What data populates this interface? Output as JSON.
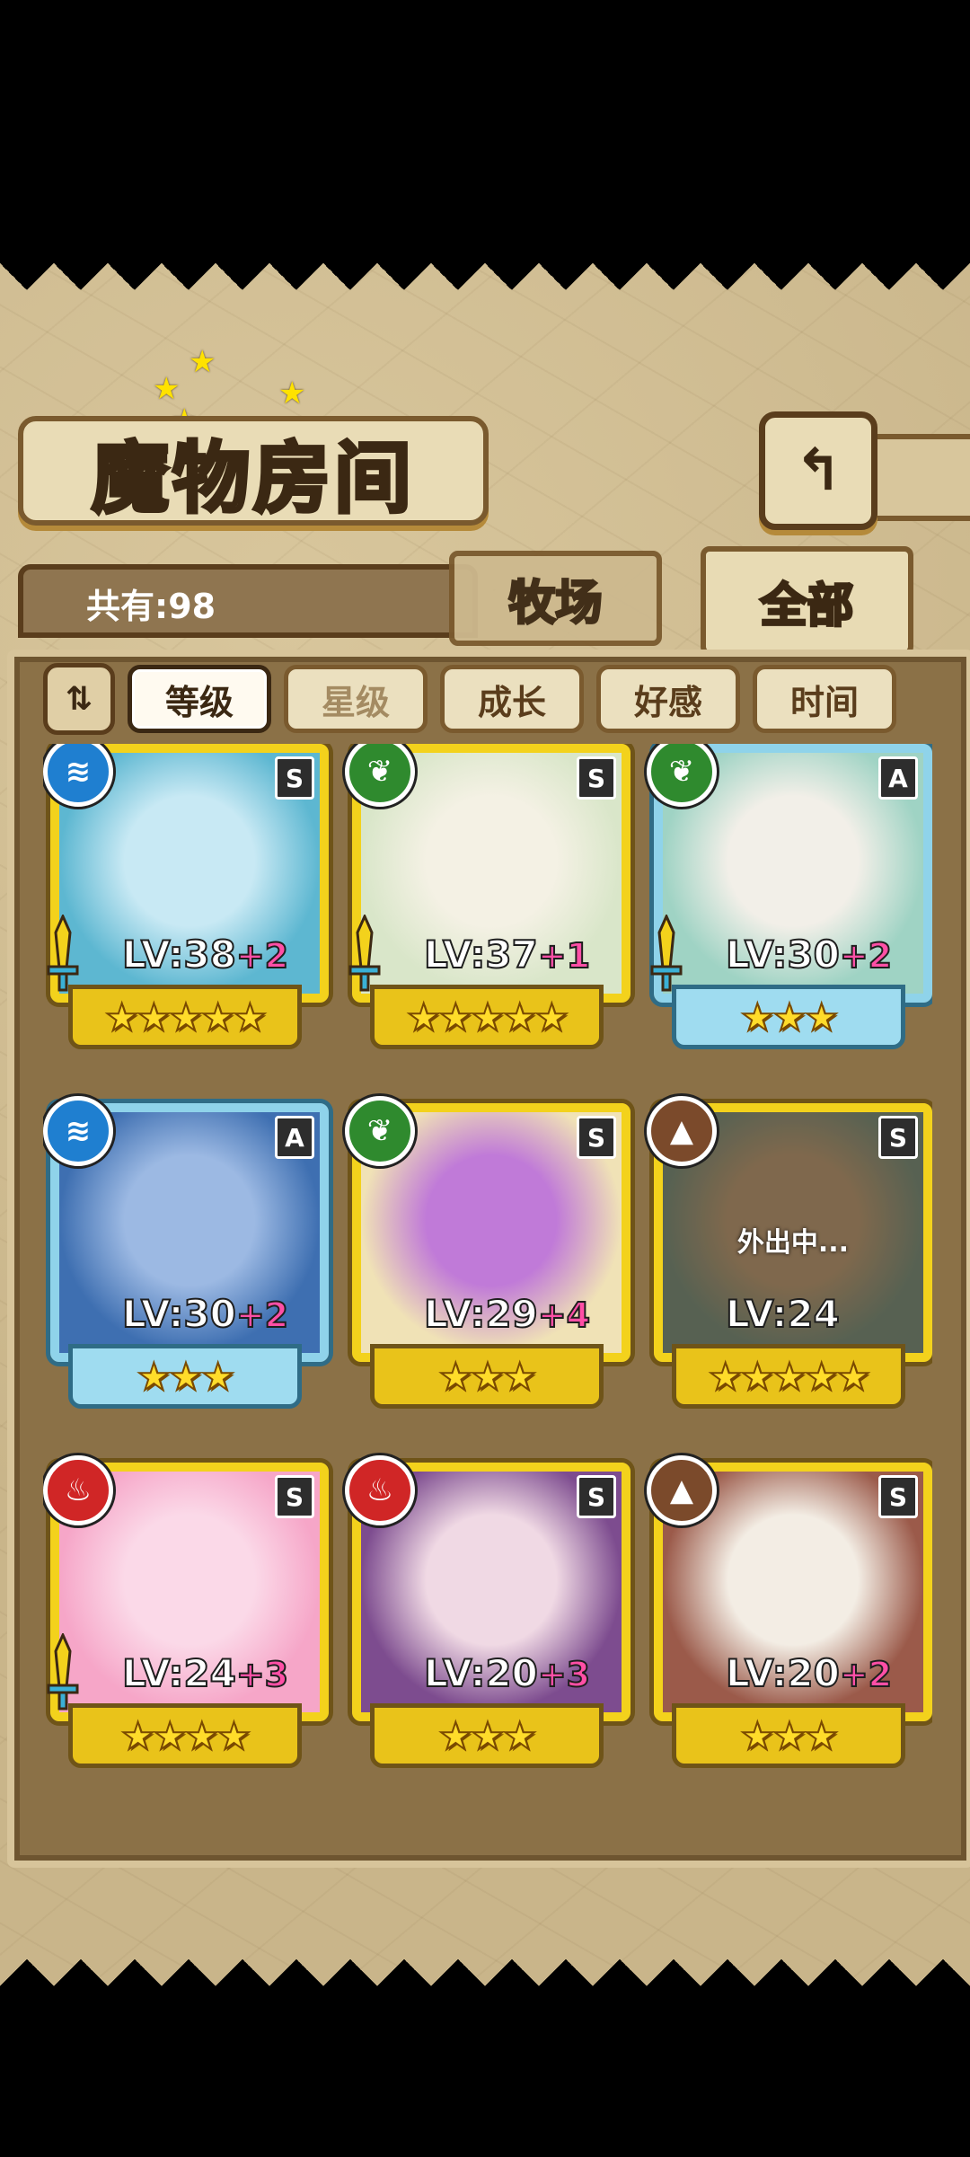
{
  "header": {
    "title": "魔物房间",
    "back_icon": "↰"
  },
  "count_label": "共有:98",
  "tabs": [
    {
      "label": "牧场"
    },
    {
      "label": "全部"
    }
  ],
  "sort": {
    "toggle_icon": "⇅",
    "buttons": [
      "等级",
      "星级",
      "成长",
      "好感",
      "时间"
    ],
    "active": "等级"
  },
  "monsters": [
    {
      "element": "water",
      "element_color": "#1f7fd0",
      "rank": "S",
      "lv": "LV:38",
      "plus": "+2",
      "stars": "★★★★★",
      "equipped": true,
      "portrait": [
        "#5db7d1",
        "#c8e9f4"
      ]
    },
    {
      "element": "leaf",
      "element_color": "#2f8a2e",
      "rank": "S",
      "lv": "LV:37",
      "plus": "+1",
      "stars": "★★★★★",
      "equipped": true,
      "portrait": [
        "#d9e6c9",
        "#f4f1e4"
      ]
    },
    {
      "element": "leaf",
      "element_color": "#2f8a2e",
      "rank": "A",
      "lv": "LV:30",
      "plus": "+2",
      "stars": "★★★",
      "equipped": true,
      "portrait": [
        "#9fd3c4",
        "#f2efe8"
      ]
    },
    {
      "element": "water",
      "element_color": "#1f7fd0",
      "rank": "A",
      "lv": "LV:30",
      "plus": "+2",
      "stars": "★★★",
      "equipped": false,
      "portrait": [
        "#3e6fb1",
        "#9cb9e3"
      ]
    },
    {
      "element": "leaf",
      "element_color": "#2f8a2e",
      "rank": "S",
      "lv": "LV:29",
      "plus": "+4",
      "stars": "★★★",
      "equipped": false,
      "portrait": [
        "#f0e2b6",
        "#c07ad8"
      ]
    },
    {
      "element": "earth",
      "element_color": "#7b4a2b",
      "rank": "S",
      "lv": "LV:24",
      "plus": "",
      "stars": "★★★★★",
      "equipped": false,
      "portrait": [
        "#6e8d7c",
        "#b79a73"
      ],
      "status": "外出中..."
    },
    {
      "element": "fire",
      "element_color": "#d02626",
      "rank": "S",
      "lv": "LV:24",
      "plus": "+3",
      "stars": "★★★★",
      "equipped": true,
      "portrait": [
        "#f6a6c8",
        "#fbd9e8"
      ]
    },
    {
      "element": "fire",
      "element_color": "#d02626",
      "rank": "S",
      "lv": "LV:20",
      "plus": "+3",
      "stars": "★★★",
      "equipped": false,
      "portrait": [
        "#7d4c8f",
        "#f0d9e4"
      ]
    },
    {
      "element": "earth",
      "element_color": "#7b4a2b",
      "rank": "S",
      "lv": "LV:20",
      "plus": "+2",
      "stars": "★★★",
      "equipped": false,
      "portrait": [
        "#9b5a4a",
        "#f3ede4"
      ]
    }
  ]
}
